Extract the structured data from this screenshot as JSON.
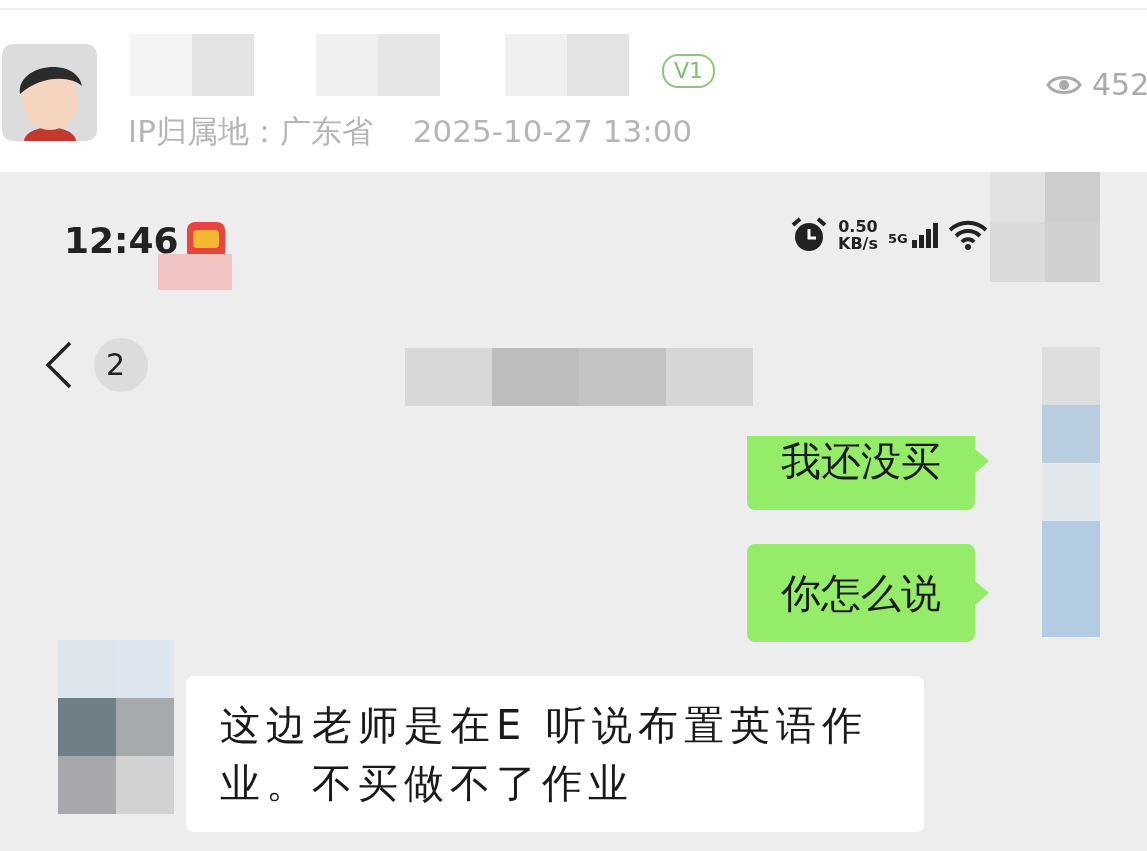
{
  "post": {
    "level_badge": "V1",
    "ip_label": "IP归属地：",
    "ip_location": "广东省",
    "time": "2025-10-27 13:00",
    "views": "452"
  },
  "status_bar": {
    "time": "12:46",
    "net_speed_value": "0.50",
    "net_speed_unit": "KB/s",
    "network": "5G"
  },
  "chat": {
    "back_label": "2",
    "messages": [
      {
        "kind": "sent",
        "text": "我还没买"
      },
      {
        "kind": "sent",
        "text": "你怎么说"
      },
      {
        "kind": "received",
        "text": "这边老师是在E 听说布置英语作业。不买做不了作业"
      }
    ]
  }
}
